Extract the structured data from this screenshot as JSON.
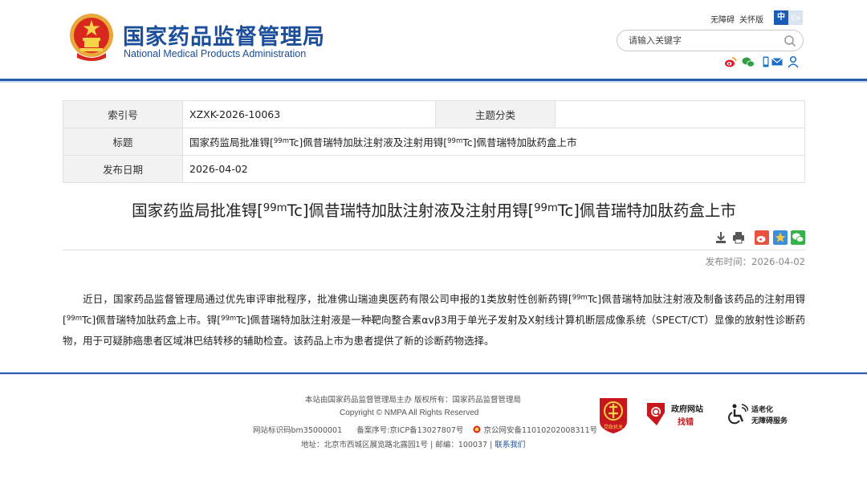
{
  "header": {
    "site_title_cn": "国家药品监督管理局",
    "site_title_en": "National Medical Products Administration",
    "topnav": [
      "无障碍",
      "关怀版"
    ],
    "lang": {
      "cn": "中",
      "en": "En"
    },
    "search": {
      "placeholder": "请输入关键字"
    },
    "share_icons": [
      "weibo-icon",
      "wechat-icon",
      "mobile-icon",
      "mail-icon",
      "user-icon"
    ],
    "brand_color": "#1b4e9b"
  },
  "meta": {
    "index_label": "索引号",
    "index_value": "XZXK-2026-10063",
    "topic_label": "主题分类",
    "topic_value": "",
    "title_label": "标题",
    "title_parts": [
      "国家药监局批准锝[",
      "99m",
      "Tc]佩昔瑞特加肽注射液及注射用锝[",
      "99m",
      "Tc]佩昔瑞特加肽药盒上市"
    ],
    "date_label": "发布日期",
    "date_value": "2026-04-02"
  },
  "article": {
    "title_parts": [
      "国家药监局批准锝[",
      "99m",
      "Tc]佩昔瑞特加肽注射液及注射用锝[",
      "99m",
      "Tc]佩昔瑞特加肽药盒上市"
    ],
    "tools": [
      "download-icon",
      "print-icon",
      "weibo-share-icon",
      "qzone-share-icon",
      "wechat-share-icon"
    ],
    "pub_time": "发布时间：2026-04-02",
    "body_parts": [
      "近日，国家药品监督管理局通过优先审评审批程序，批准佛山瑞迪奥医药有限公司申报的1类放射性创新药锝[",
      "99m",
      "Tc]佩昔瑞特加肽注射液及制备该药品的注射用锝[",
      "99m",
      "Tc]佩昔瑞特加肽药盒上市。锝[",
      "99m",
      "Tc]佩昔瑞特加肽注射液是一种靶向整合素αvβ3用于单光子发射及X射线计算机断层成像系统（SPECT/CT）显像的放射性诊断药物，用于可疑肺癌患者区域淋巴结转移的辅助检查。该药品上市为患者提供了新的诊断药物选择。"
    ]
  },
  "footer": {
    "line1": "本站由国家药品监督管理局主办 版权所有：国家药品监督管理局",
    "line2": "Copyright © NMPA All Rights Reserved",
    "line3_a": "网站标识码bm35000001",
    "line3_b": "备案序号:京ICP备13027807号",
    "line3_c": "京公网安备11010202008311号",
    "line4": "地址：北京市西城区展览路北露园1号 | 邮编：100037 |",
    "line4_link": "联系我们",
    "badge_find": {
      "line1": "政府网站",
      "line2": "找错"
    },
    "badge_access": {
      "line1": "适老化",
      "line2": "无障碍服务"
    },
    "badge_red_text": "党政机关"
  }
}
